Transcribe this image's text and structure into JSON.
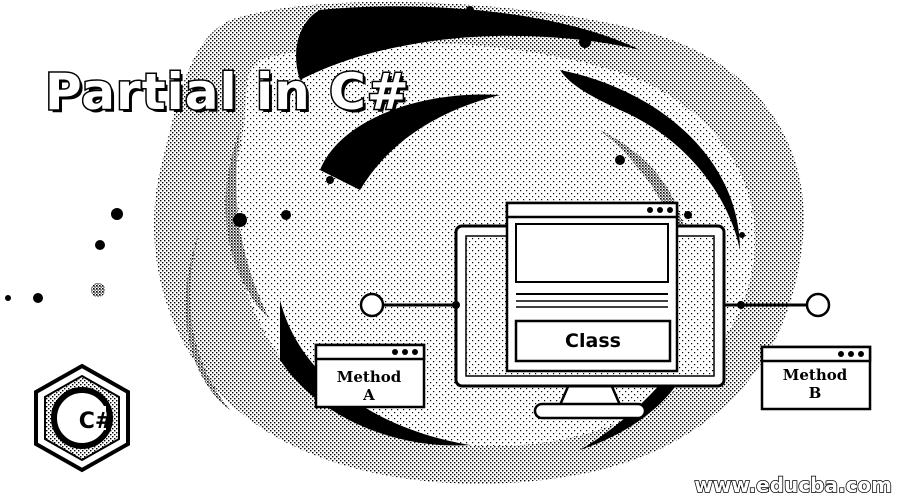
{
  "banner": {
    "title": "Partial in C#",
    "website": "www.educba.com",
    "logo_label": "C#",
    "logo_icon": "csharp-logo-icon"
  },
  "diagram": {
    "class_label": "Class",
    "method_a_label": "Method\nA",
    "method_b_label": "Method\nB"
  },
  "colors": {
    "ink": "#000000",
    "paper": "#ffffff",
    "dither": "#3a3a3a"
  }
}
